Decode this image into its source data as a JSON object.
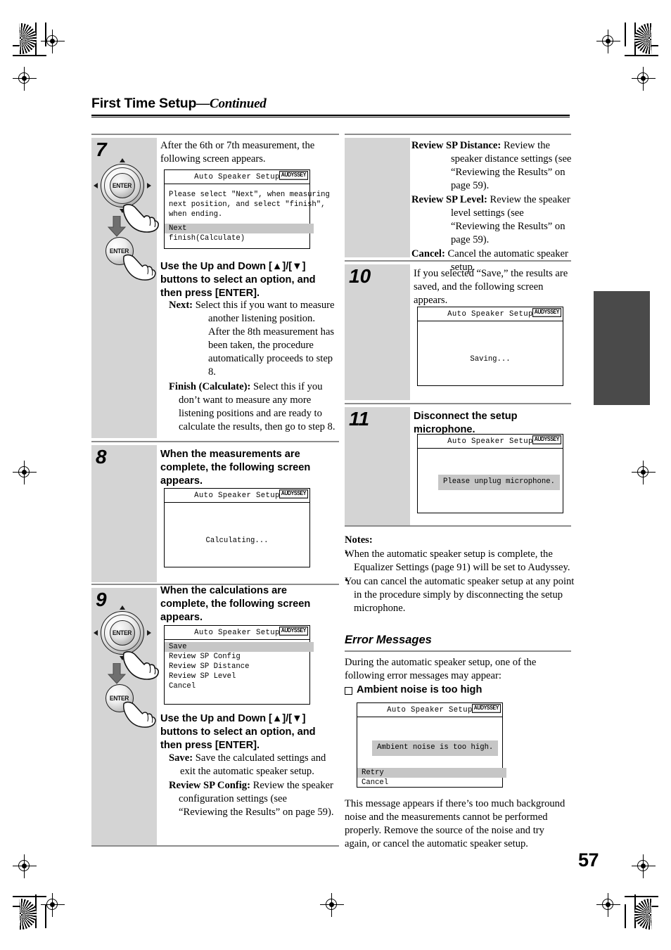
{
  "document": {
    "running_head_title": "First Time Setup",
    "running_head_continued": "—Continued",
    "page_number": "57"
  },
  "osd_common": {
    "title": "Auto Speaker Setup",
    "badge": "AUDYSSEY"
  },
  "steps": [
    {
      "number": "7",
      "intro": "After the 6th or 7th measurement, the following screen appears.",
      "screen": {
        "title": "Auto Speaker Setup",
        "badge": "AUDYSSEY",
        "message": "Please select \"Next\", when measuring\nnext position, and select \"finish\",\nwhen ending.",
        "options": [
          {
            "label": "Next",
            "selected": true
          },
          {
            "label": "finish(Calculate)",
            "selected": false
          }
        ]
      },
      "instruction": "Use the Up and Down [▲]/[▼] buttons to select an option, and then press [ENTER].",
      "definitions": [
        {
          "term": "Next:",
          "desc": "Select this if you want to measure another listening position. After the 8th measurement has been taken, the procedure automatically proceeds to step 8."
        },
        {
          "term": "Finish (Calculate):",
          "desc": "Select this if you don’t want to measure any more listening positions and are ready to calculate the results, then go to step 8."
        }
      ]
    },
    {
      "number": "8",
      "intro": "When the measurements are complete, the following screen appears.",
      "screen": {
        "title": "Auto Speaker Setup",
        "badge": "AUDYSSEY",
        "center_text": "Calculating..."
      }
    },
    {
      "number": "9",
      "intro": "When the calculations are complete, the following screen appears.",
      "screen": {
        "title": "Auto Speaker Setup",
        "badge": "AUDYSSEY",
        "options": [
          {
            "label": "Save",
            "selected": true
          },
          {
            "label": "Review SP Config",
            "selected": false
          },
          {
            "label": "Review SP Distance",
            "selected": false
          },
          {
            "label": "Review SP Level",
            "selected": false
          },
          {
            "label": "Cancel",
            "selected": false
          }
        ]
      },
      "instruction": "Use the Up and Down [▲]/[▼] buttons to select an option, and then press [ENTER].",
      "definitions": [
        {
          "term": "Save:",
          "desc": "Save the calculated settings and exit the automatic speaker setup."
        },
        {
          "term": "Review SP Config:",
          "desc": "Review the speaker configuration settings (see “Reviewing the Results” on page 59)."
        },
        {
          "term": "Review SP Distance:",
          "desc": "Review the speaker distance settings (see “Reviewing the Results” on page 59)."
        },
        {
          "term": "Review SP Level:",
          "desc": "Review the speaker level settings (see “Reviewing the Results” on page 59)."
        },
        {
          "term": "Cancel:",
          "desc": "Cancel the automatic speaker setup."
        }
      ]
    },
    {
      "number": "10",
      "intro": "If you selected “Save,” the results are saved, and the following screen appears.",
      "screen": {
        "title": "Auto Speaker Setup",
        "badge": "AUDYSSEY",
        "center_text": "Saving..."
      }
    },
    {
      "number": "11",
      "intro": "Disconnect the setup microphone.",
      "screen": {
        "title": "Auto Speaker Setup",
        "badge": "AUDYSSEY",
        "message_box": "Please unplug microphone."
      }
    }
  ],
  "notes": {
    "title": "Notes:",
    "items": [
      "When the automatic speaker setup is complete, the Equalizer Settings (page 91) will be set to Audyssey.",
      "You can cancel the automatic speaker setup at any point in the procedure simply by disconnecting the setup microphone."
    ]
  },
  "error_messages": {
    "heading": "Error Messages",
    "intro": "During the automatic speaker setup, one of the following error messages may appear:",
    "entry_title": "Ambient noise is too high",
    "screen": {
      "title": "Auto Speaker Setup",
      "badge": "AUDYSSEY",
      "message_box": "Ambient noise is too high.",
      "options": [
        {
          "label": "Retry",
          "selected": true
        },
        {
          "label": "Cancel",
          "selected": false
        }
      ]
    },
    "explanation": "This message appears if there’s too much background noise and the measurements cannot be performed properly. Remove the source of the noise and try again, or cancel the automatic speaker setup."
  },
  "illustrations": {
    "dial_label": "ENTER",
    "enter_button_label": "ENTER"
  },
  "colors": {
    "step_cell_bg": "#d4d4d4",
    "osd_highlight": "#c6c6c6",
    "rule": "#8c8c8c",
    "thumb_tab": "#4a4a4a"
  }
}
